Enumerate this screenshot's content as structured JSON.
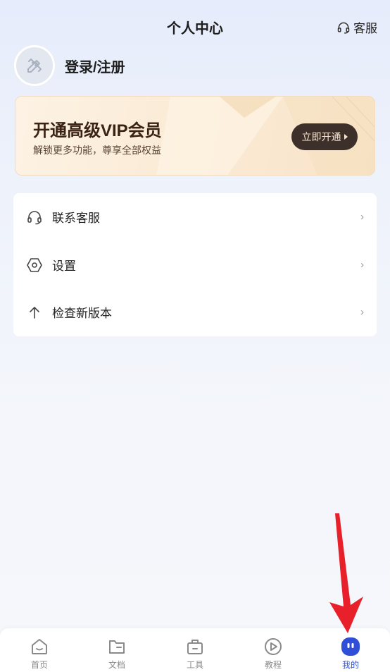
{
  "header": {
    "title": "个人中心",
    "customer_service_label": "客服",
    "icon": "headset-icon"
  },
  "profile": {
    "avatar_icon": "pencil-ruler-icon",
    "login_label": "登录/注册"
  },
  "vip_card": {
    "title": "开通高级VIP会员",
    "subtitle": "解锁更多功能，尊享全部权益",
    "button_label": "立即开通"
  },
  "menu": {
    "items": [
      {
        "label": "联系客服",
        "icon": "headset-icon"
      },
      {
        "label": "设置",
        "icon": "hexagon-settings-icon"
      },
      {
        "label": "检查新版本",
        "icon": "arrow-up-icon"
      }
    ],
    "arrow": "›"
  },
  "tabbar": {
    "items": [
      {
        "label": "首页",
        "icon": "home-icon",
        "active": false
      },
      {
        "label": "文档",
        "icon": "folder-icon",
        "active": false
      },
      {
        "label": "工具",
        "icon": "toolbox-icon",
        "active": false
      },
      {
        "label": "教程",
        "icon": "play-circle-icon",
        "active": false
      },
      {
        "label": "我的",
        "icon": "profile-face-icon",
        "active": true
      }
    ]
  },
  "colors": {
    "accent": "#2f4fd8",
    "annotation_arrow": "#e8202a",
    "vip_button": "#3d2f2a"
  }
}
